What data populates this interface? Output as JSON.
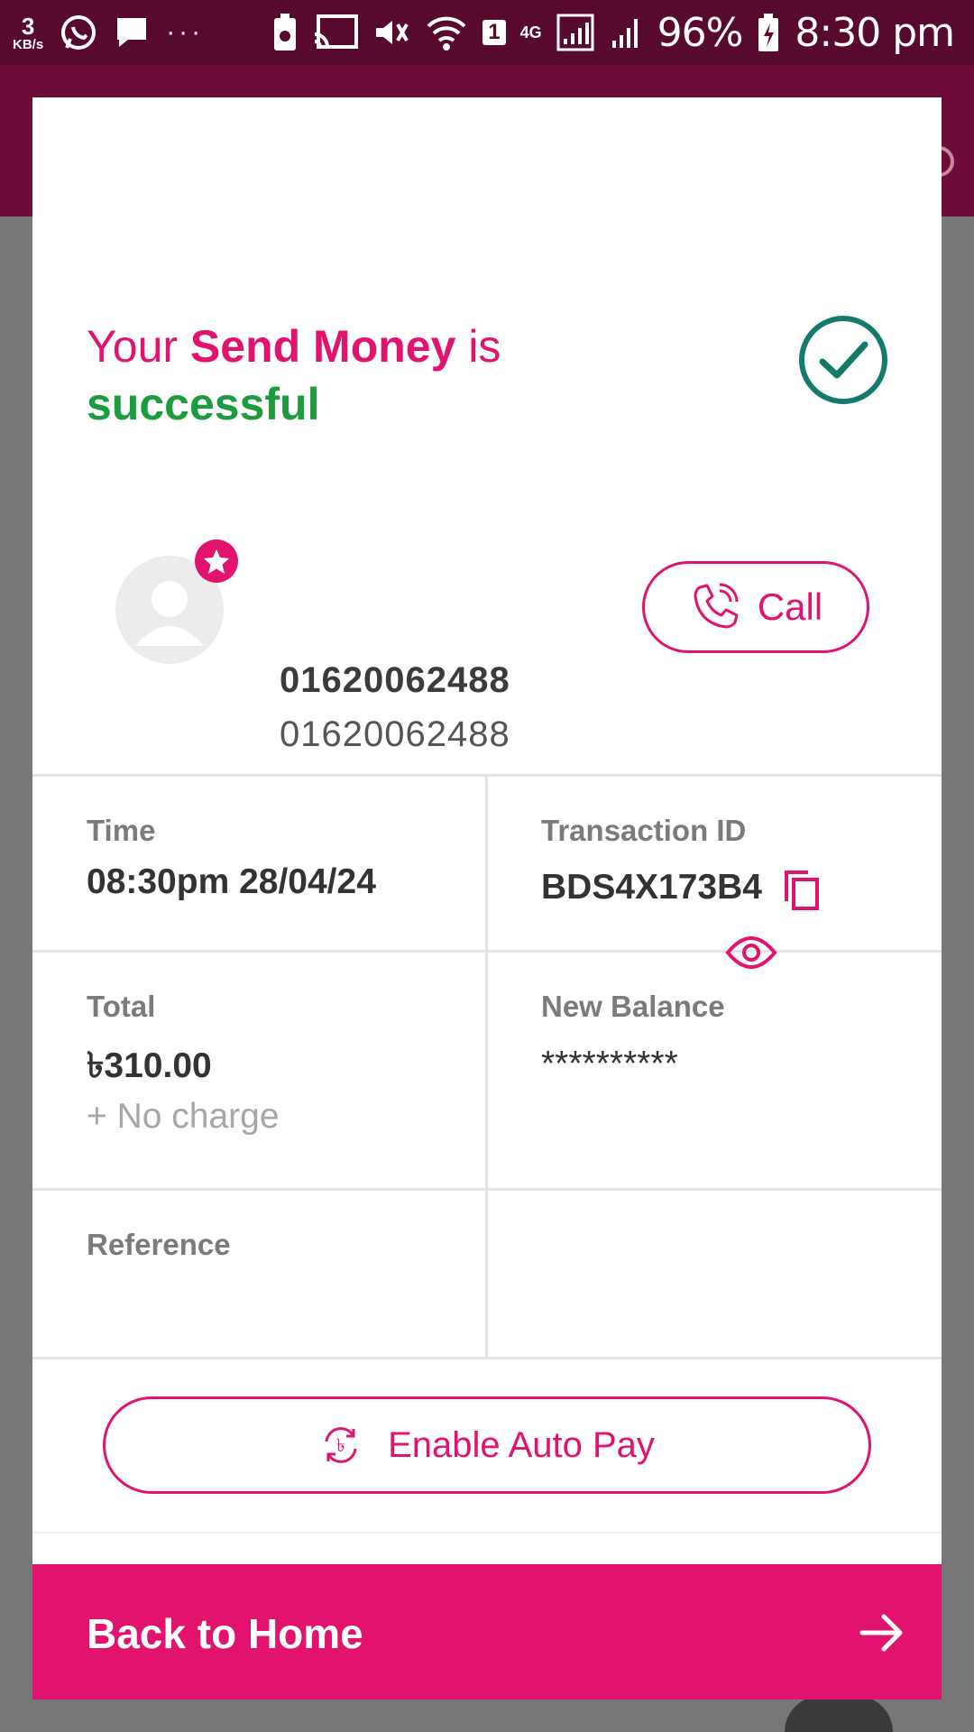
{
  "status_bar": {
    "net_speed_value": "3",
    "net_speed_unit": "KB/s",
    "overflow_dots": "···",
    "sim_badge": "1",
    "network_type": "4G",
    "battery_percent": "96%",
    "time": "8:30 pm"
  },
  "header": {
    "prefix": "Your ",
    "service": "Send Money",
    "middle": " is",
    "status": "successful"
  },
  "recipient": {
    "name": "01620062488",
    "number": "01620062488",
    "call_label": "Call"
  },
  "details": {
    "time_label": "Time",
    "time_value": "08:30pm 28/04/24",
    "txn_label": "Transaction ID",
    "txn_value": "BDS4X173B4",
    "total_label": "Total",
    "total_value": "৳310.00",
    "charge_note": "+ No charge",
    "balance_label": "New Balance",
    "balance_masked": "**********",
    "reference_label": "Reference"
  },
  "actions": {
    "autopay_label": "Enable Auto Pay",
    "home_label": "Back to Home"
  },
  "colors": {
    "brand": "#e2136e",
    "success": "#1c9c3c",
    "status_bar": "#570a2d"
  },
  "icons": [
    "whatsapp-icon",
    "message-icon",
    "battery-saver-icon",
    "cast-icon",
    "vibrate-icon",
    "wifi-icon",
    "signal-icon",
    "battery-icon",
    "check-circle-icon",
    "avatar-icon",
    "star-icon",
    "phone-icon",
    "copy-icon",
    "eye-icon",
    "autopay-icon",
    "arrow-right-icon"
  ]
}
